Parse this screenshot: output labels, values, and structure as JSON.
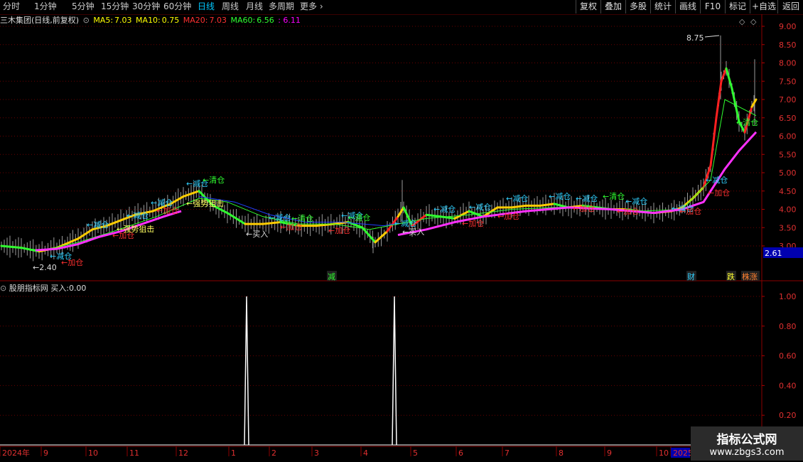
{
  "toolbar": {
    "periods": [
      "分时",
      "1分钟",
      "5分钟",
      "15分钟",
      "30分钟",
      "60分钟",
      "日线",
      "周线",
      "月线",
      "多周期",
      "更多"
    ],
    "active_period": "日线",
    "right_buttons": [
      "复权",
      "叠加",
      "多股",
      "统计",
      "画线",
      "F10",
      "标记",
      "+自选",
      "返回"
    ]
  },
  "main_info": {
    "title": "三木集团(日线,前复权)",
    "ma5_label": "MA5:",
    "ma5": "7.03",
    "ma10_label": "MA10:",
    "ma10": "0.75",
    "ma20_label": "MA20:",
    "ma20": "7.03",
    "ma60_label": "MA60:",
    "ma60": "6.56",
    "extra": ": 6.11",
    "colors": {
      "ma5": "#ffff00",
      "ma10": "#ffff00",
      "ma20": "#ff3030",
      "ma60": "#30ff30",
      "extra": "#ff00ff"
    }
  },
  "price_axis": {
    "ticks": [
      "9.00",
      "8.50",
      "8.00",
      "7.50",
      "7.00",
      "6.50",
      "6.00",
      "5.50",
      "5.00",
      "4.50",
      "4.00",
      "3.50",
      "3.00"
    ],
    "current_value": "2.61"
  },
  "sub_info": {
    "title": "股朋指标网",
    "buy_label": "买入:",
    "buy_value": "0.00"
  },
  "indicator_axis": {
    "ticks": [
      "1.00",
      "0.80",
      "0.60",
      "0.40",
      "0.20"
    ]
  },
  "time_axis": {
    "labels": [
      "2024年",
      "9",
      "10",
      "11",
      "12",
      "1",
      "2",
      "3",
      "4",
      "5",
      "6",
      "7",
      "8",
      "9",
      "10",
      "2025"
    ]
  },
  "annotations": {
    "high": "8.75",
    "low": "←2.40",
    "reduce": "←减仓",
    "add": "←加仓",
    "clear": "←清仓",
    "buy": "←买入",
    "strong": "←强势狙击"
  },
  "event_markers": [
    "减",
    "财",
    "跌",
    "株涨"
  ],
  "watermark": {
    "title": "指标公式网",
    "url": "www.zbgs3.com"
  },
  "chart_data": {
    "type": "line",
    "x": [
      "2024-08",
      "2024-09",
      "2024-10",
      "2024-11",
      "2024-12",
      "2025-01",
      "2025-02",
      "2025-03",
      "2025-04",
      "2025-05",
      "2025-06",
      "2025-07",
      "2025-08",
      "2025-09",
      "2025-10",
      "2025-11"
    ],
    "series": [
      {
        "name": "MA5",
        "values": [
          2.7,
          3.5,
          3.7,
          3.9,
          4.4,
          3.6,
          3.55,
          3.6,
          3.3,
          3.85,
          3.8,
          3.95,
          4.05,
          4.0,
          3.95,
          7.03
        ]
      },
      {
        "name": "MA60",
        "values": [
          2.6,
          2.9,
          3.3,
          3.6,
          3.9,
          3.75,
          3.55,
          3.55,
          3.5,
          3.55,
          3.7,
          3.9,
          4.0,
          3.95,
          3.95,
          6.56
        ]
      }
    ],
    "ylim": [
      2.6,
      9.2
    ],
    "indicator": {
      "name": "买入",
      "spikes_at": [
        "2025-01",
        "2025-04"
      ],
      "value": 1.0,
      "ylim": [
        0,
        1.05
      ]
    }
  }
}
